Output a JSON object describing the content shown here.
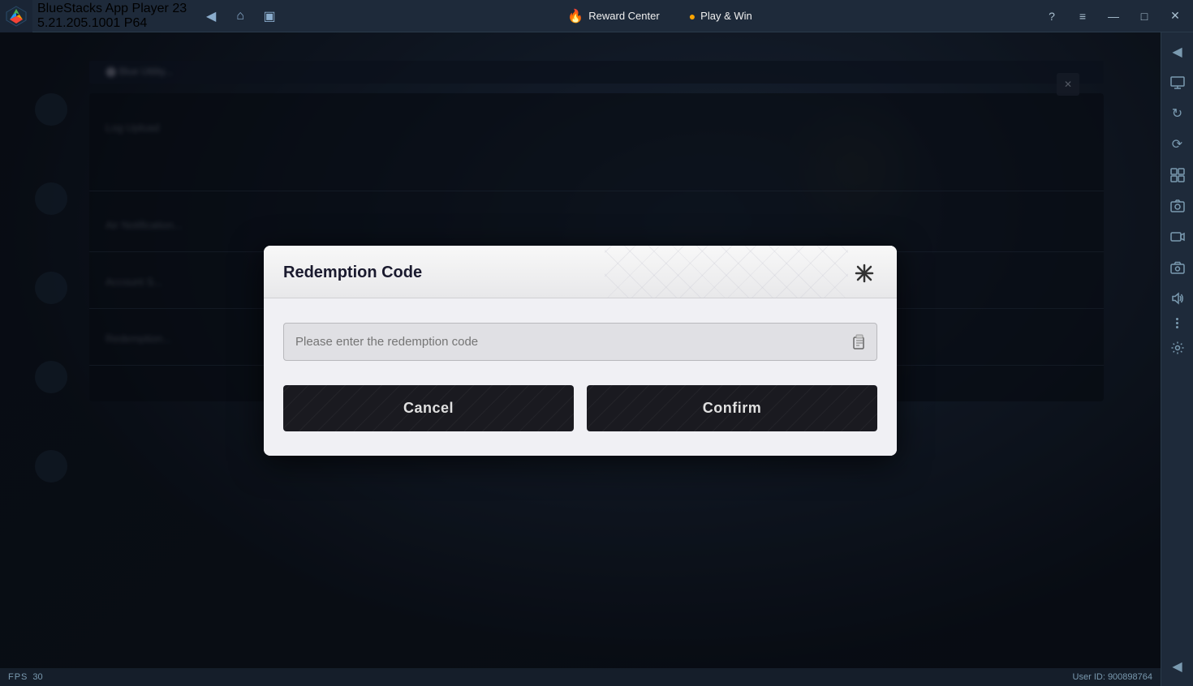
{
  "titlebar": {
    "app_name": "BlueStacks App Player 23",
    "app_version": "5.21.205.1001 P64",
    "reward_center_label": "Reward Center",
    "play_win_label": "Play & Win",
    "nav_back_icon": "◀",
    "nav_home_icon": "⌂",
    "nav_recents_icon": "▣",
    "help_icon": "?",
    "menu_icon": "≡",
    "minimize_icon": "—",
    "maximize_icon": "□",
    "close_icon": "✕"
  },
  "statusbar": {
    "fps_label": "FPS",
    "fps_value": "30",
    "user_id_label": "User ID: 900898764"
  },
  "dialog": {
    "title": "Redemption Code",
    "input_placeholder": "Please enter the redemption code",
    "cancel_label": "Cancel",
    "confirm_label": "Confirm",
    "close_icon": "✕"
  },
  "sidebar": {
    "icons": [
      {
        "name": "arrow-left",
        "symbol": "◀"
      },
      {
        "name": "monitor",
        "symbol": "🖥"
      },
      {
        "name": "rotate",
        "symbol": "↻"
      },
      {
        "name": "sync",
        "symbol": "⟳"
      },
      {
        "name": "grid",
        "symbol": "⊞"
      },
      {
        "name": "screenshot",
        "symbol": "📷"
      },
      {
        "name": "record",
        "symbol": "⏺"
      },
      {
        "name": "camera",
        "symbol": "📸"
      },
      {
        "name": "volume",
        "symbol": "🔊"
      },
      {
        "name": "settings",
        "symbol": "⚙"
      },
      {
        "name": "arrow-left-2",
        "symbol": "◀"
      }
    ]
  }
}
